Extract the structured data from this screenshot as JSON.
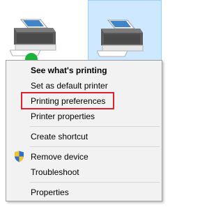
{
  "menu": {
    "items": [
      {
        "label": "See what's printing",
        "bold": true
      },
      {
        "label": "Set as default printer"
      },
      {
        "label": "Printing preferences"
      },
      {
        "label": "Printer properties"
      },
      {
        "label": "Create shortcut"
      },
      {
        "label": "Remove device",
        "icon": "uac-shield-icon"
      },
      {
        "label": "Troubleshoot"
      },
      {
        "label": "Properties"
      }
    ]
  },
  "colors": {
    "highlight_border": "#e0202f",
    "selection_fill": "#cde8ff",
    "default_badge": "#1db33a"
  },
  "icons": [
    "printer-icon",
    "printer-icon",
    "default-check-icon",
    "uac-shield-icon"
  ]
}
